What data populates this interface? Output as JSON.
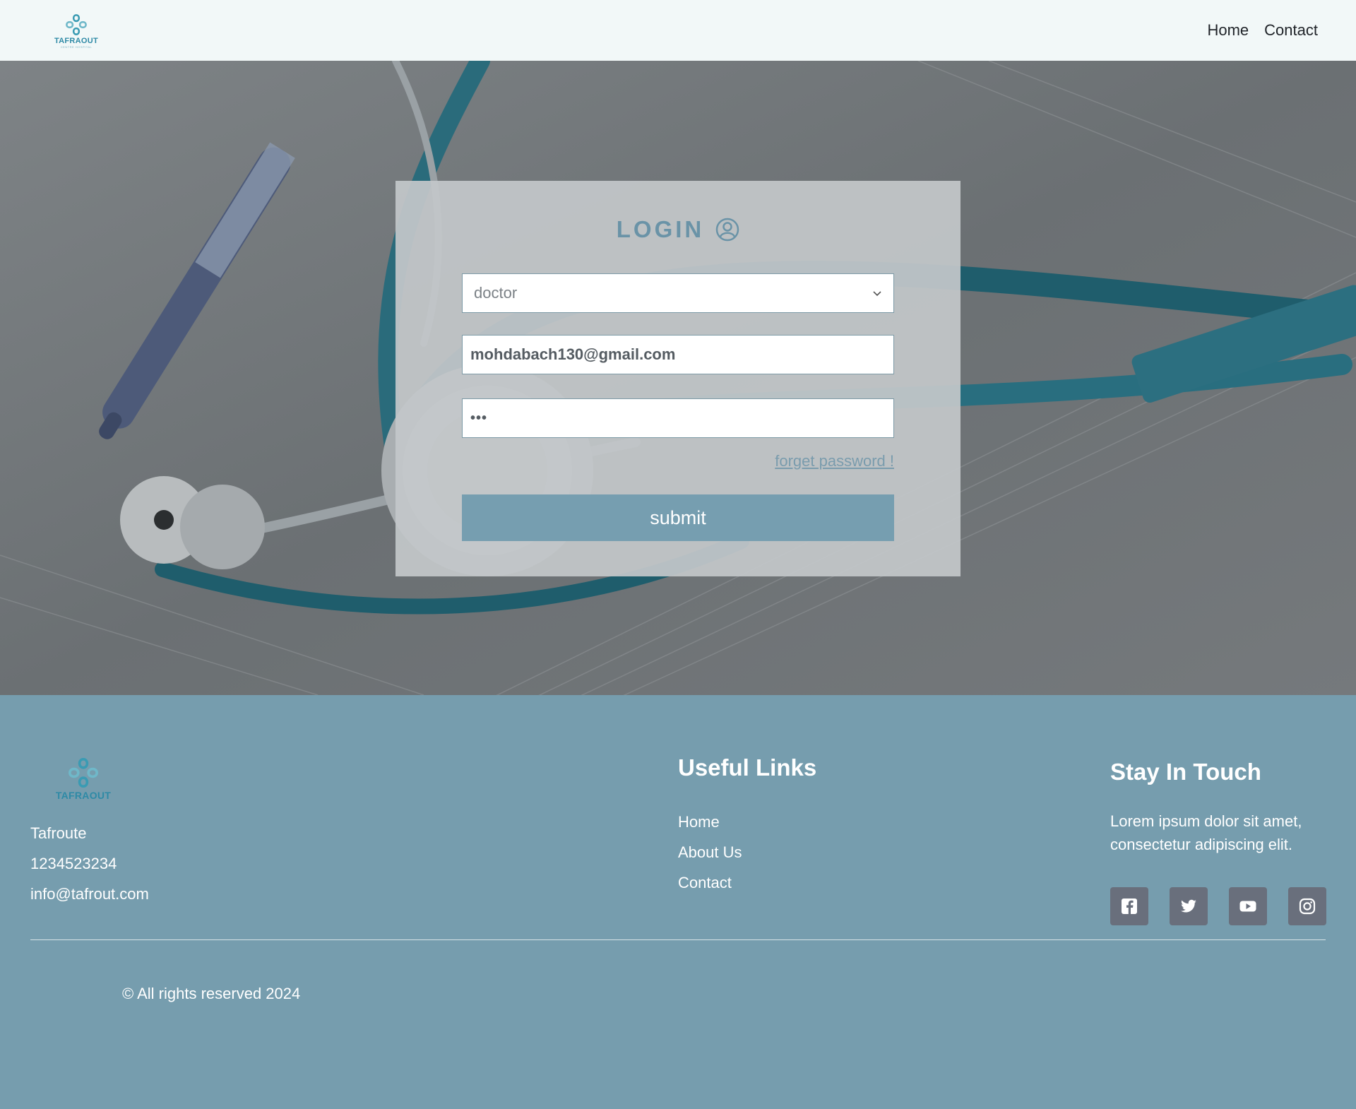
{
  "nav": {
    "brand": "TAFRAOUT",
    "brand_sub": "CENTRE HOSPITAL",
    "links": [
      "Home",
      "Contact"
    ]
  },
  "login": {
    "title": "LOGIN",
    "role_select": {
      "value": "doctor"
    },
    "email": {
      "value": "mohdabach130@gmail.com"
    },
    "password": {
      "display": "•••"
    },
    "forget_link": "forget password !",
    "submit_label": "submit"
  },
  "footer": {
    "brand": "TAFRAOUT",
    "info": [
      "Tafroute",
      "1234523234",
      "info@tafrout.com"
    ],
    "useful_links_title": "Useful Links",
    "useful_links": [
      "Home",
      "About Us",
      "Contact"
    ],
    "stay_title": "Stay In Touch",
    "stay_text": "Lorem ipsum dolor sit amet, consectetur adipiscing elit.",
    "socials": [
      "facebook-icon",
      "twitter-icon",
      "youtube-icon",
      "instagram-icon"
    ],
    "copyright": "© All rights reserved 2024"
  },
  "colors": {
    "accent": "#769dae",
    "nav_bg": "#f2f8f8",
    "brand_teal": "#2e8aa6",
    "social_bg": "#696f7c"
  }
}
